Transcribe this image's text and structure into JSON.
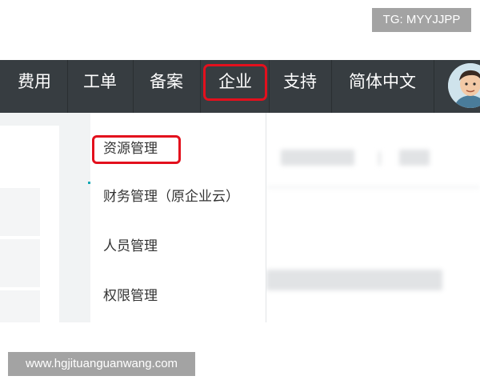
{
  "watermarks": {
    "top": "TG: MYYJJPP",
    "bottom": "www.hgjituanguanwang.com"
  },
  "navbar": {
    "items": [
      {
        "label": "费用"
      },
      {
        "label": "工单"
      },
      {
        "label": "备案"
      },
      {
        "label": "企业"
      },
      {
        "label": "支持"
      },
      {
        "label": "简体中文"
      }
    ],
    "active_item": "企业"
  },
  "dropdown": {
    "items": [
      {
        "label": "资源管理"
      },
      {
        "label": "财务管理（原企业云）"
      },
      {
        "label": "人员管理"
      },
      {
        "label": "权限管理"
      }
    ],
    "highlighted_item": "资源管理"
  },
  "colors": {
    "navbar_bg": "#373d41",
    "highlight_border": "#e3101d",
    "accent": "#12a8b4"
  },
  "icons": {
    "avatar": "user-avatar-icon"
  }
}
